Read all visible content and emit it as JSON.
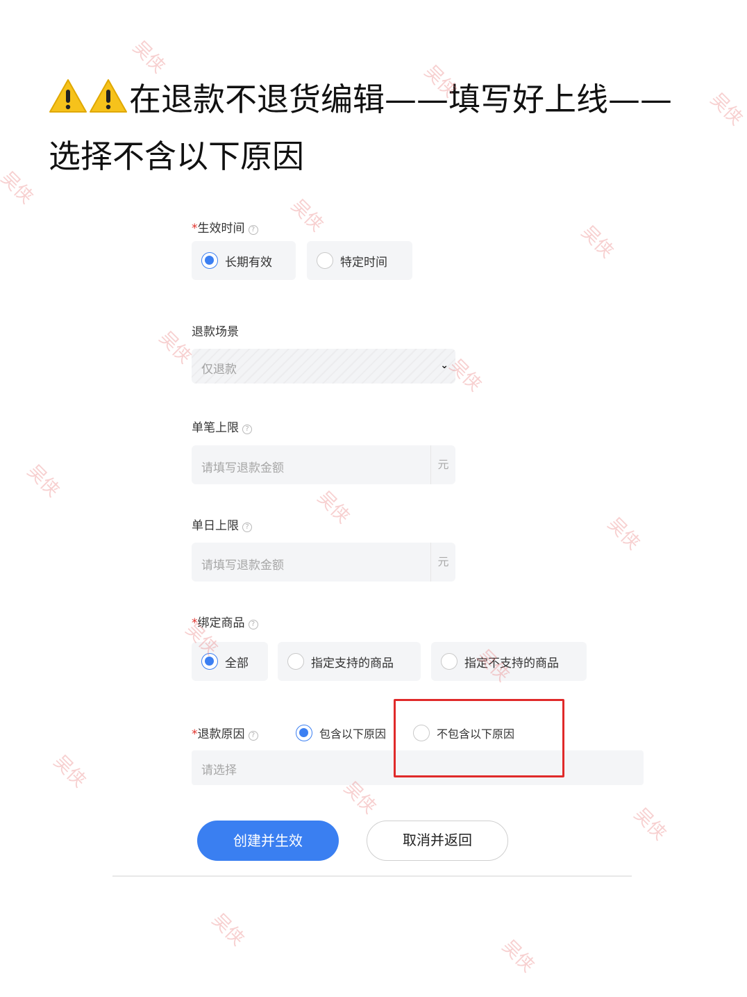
{
  "headline": {
    "line1": "在退款不退货编辑——填写好上线——",
    "line2": "选择不含以下原因"
  },
  "effective_time": {
    "required_mark": "*",
    "label": "生效时间",
    "help": "?",
    "options": [
      "长期有效",
      "特定时间"
    ],
    "selected": "长期有效"
  },
  "refund_scene": {
    "label": "退款场景",
    "value": "仅退款"
  },
  "per_order_limit": {
    "label": "单笔上限",
    "help": "?",
    "placeholder": "请填写退款金额",
    "unit": "元"
  },
  "daily_limit": {
    "label": "单日上限",
    "help": "?",
    "placeholder": "请填写退款金额",
    "unit": "元"
  },
  "bind_products": {
    "required_mark": "*",
    "label": "绑定商品",
    "help": "?",
    "options": [
      "全部",
      "指定支持的商品",
      "指定不支持的商品"
    ],
    "selected": "全部"
  },
  "refund_reason": {
    "required_mark": "*",
    "label": "退款原因",
    "help": "?",
    "options": [
      "包含以下原因",
      "不包含以下原因"
    ],
    "selected": "包含以下原因",
    "placeholder": "请选择"
  },
  "actions": {
    "primary": "创建并生效",
    "cancel": "取消并返回"
  },
  "watermark": "吴侠",
  "colors": {
    "accent": "#3a7ff1",
    "required": "#e0322b",
    "highlight": "#e02a2a"
  }
}
